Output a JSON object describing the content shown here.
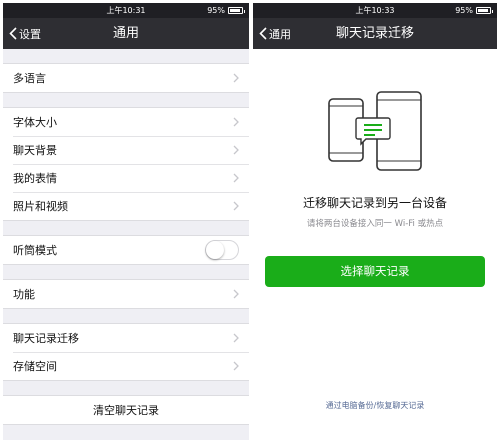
{
  "left_screen": {
    "status": {
      "time": "上午10:31",
      "battery": "95%",
      "battery_level": 0.95
    },
    "nav": {
      "back_label": "设置",
      "title": "通用"
    },
    "groups": [
      {
        "items": [
          "多语言"
        ]
      },
      {
        "items": [
          "字体大小",
          "聊天背景",
          "我的表情",
          "照片和视频"
        ]
      },
      {
        "items": [
          "听筒模式"
        ],
        "toggle_on": false
      },
      {
        "items": [
          "功能"
        ]
      },
      {
        "items": [
          "聊天记录迁移",
          "存储空间"
        ]
      },
      {
        "items": [
          "清空聊天记录"
        ]
      }
    ]
  },
  "right_screen": {
    "status": {
      "time": "上午10:33",
      "battery": "95%",
      "battery_level": 0.95
    },
    "nav": {
      "back_label": "通用",
      "title": "聊天记录迁移"
    },
    "heading": "迁移聊天记录到另一台设备",
    "subtext": "请将两台设备接入同一 Wi-Fi 或热点",
    "primary_button": "选择聊天记录",
    "footer_link": "通过电脑备份/恢复聊天记录",
    "colors": {
      "accent": "#1aad19",
      "link": "#576b95",
      "nav_bg": "#2e2e33"
    }
  }
}
